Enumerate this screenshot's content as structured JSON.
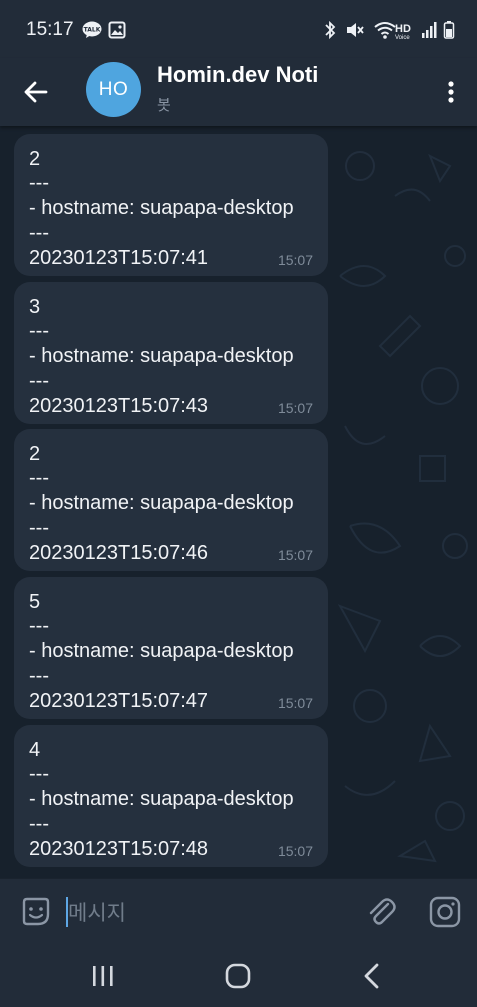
{
  "status_bar": {
    "time": "15:17",
    "left_icons": [
      "talk-notification-icon",
      "image-notification-icon"
    ],
    "right_icons": [
      "bluetooth-icon",
      "mute-icon",
      "wifi-icon",
      "hd-voice-icon",
      "signal-icon",
      "battery-icon"
    ],
    "hd_label": "HD",
    "hd_sub": "Voice"
  },
  "header": {
    "avatar_initials": "HO",
    "avatar_color": "#4fa5df",
    "title": "Homin.dev Noti",
    "subtitle": "봇"
  },
  "messages": [
    {
      "lines": [
        "2",
        "---",
        "- hostname: suapapa-desktop",
        "---",
        "20230123T15:07:41"
      ],
      "time": "15:07"
    },
    {
      "lines": [
        "3",
        "---",
        "- hostname: suapapa-desktop",
        "---",
        "20230123T15:07:43"
      ],
      "time": "15:07"
    },
    {
      "lines": [
        "2",
        "---",
        "- hostname: suapapa-desktop",
        "---",
        "20230123T15:07:46"
      ],
      "time": "15:07"
    },
    {
      "lines": [
        "5",
        "---",
        "- hostname: suapapa-desktop",
        "---",
        "20230123T15:07:47"
      ],
      "time": "15:07"
    },
    {
      "lines": [
        "4",
        "---",
        "- hostname: suapapa-desktop",
        "---",
        "20230123T15:07:48"
      ],
      "time": "15:07"
    }
  ],
  "input": {
    "placeholder": "메시지",
    "value": ""
  },
  "colors": {
    "accent": "#5ea7e5",
    "bubble": "#25303e",
    "header": "#222c39",
    "background": "#17212c"
  }
}
